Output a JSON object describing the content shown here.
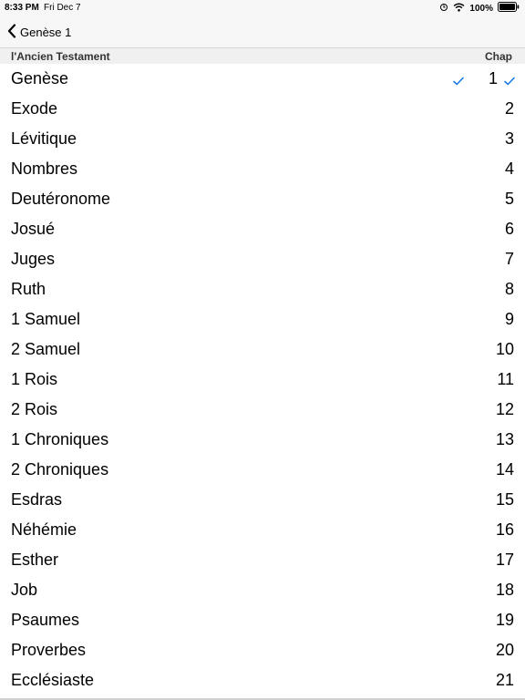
{
  "status_bar": {
    "time": "8:33 PM",
    "date": "Fri Dec 7",
    "battery": "100%"
  },
  "nav": {
    "back_label": "Genèse 1"
  },
  "section": {
    "title": "l'Ancien Testament",
    "chap_header": "Chap"
  },
  "colors": {
    "accent": "#1a7ce5"
  },
  "books": [
    {
      "name": "Genèse",
      "chap": "1",
      "selected": true
    },
    {
      "name": "Exode",
      "chap": "2"
    },
    {
      "name": "Lévitique",
      "chap": "3"
    },
    {
      "name": "Nombres",
      "chap": "4"
    },
    {
      "name": "Deutéronome",
      "chap": "5"
    },
    {
      "name": "Josué",
      "chap": "6"
    },
    {
      "name": "Juges",
      "chap": "7"
    },
    {
      "name": "Ruth",
      "chap": "8"
    },
    {
      "name": "1 Samuel",
      "chap": "9"
    },
    {
      "name": "2 Samuel",
      "chap": "10"
    },
    {
      "name": "1 Rois",
      "chap": "11"
    },
    {
      "name": "2 Rois",
      "chap": "12"
    },
    {
      "name": "1 Chroniques",
      "chap": "13"
    },
    {
      "name": "2 Chroniques",
      "chap": "14"
    },
    {
      "name": "Esdras",
      "chap": "15"
    },
    {
      "name": "Néhémie",
      "chap": "16"
    },
    {
      "name": "Esther",
      "chap": "17"
    },
    {
      "name": "Job",
      "chap": "18"
    },
    {
      "name": "Psaumes",
      "chap": "19"
    },
    {
      "name": "Proverbes",
      "chap": "20"
    },
    {
      "name": "Ecclésiaste",
      "chap": "21"
    }
  ]
}
